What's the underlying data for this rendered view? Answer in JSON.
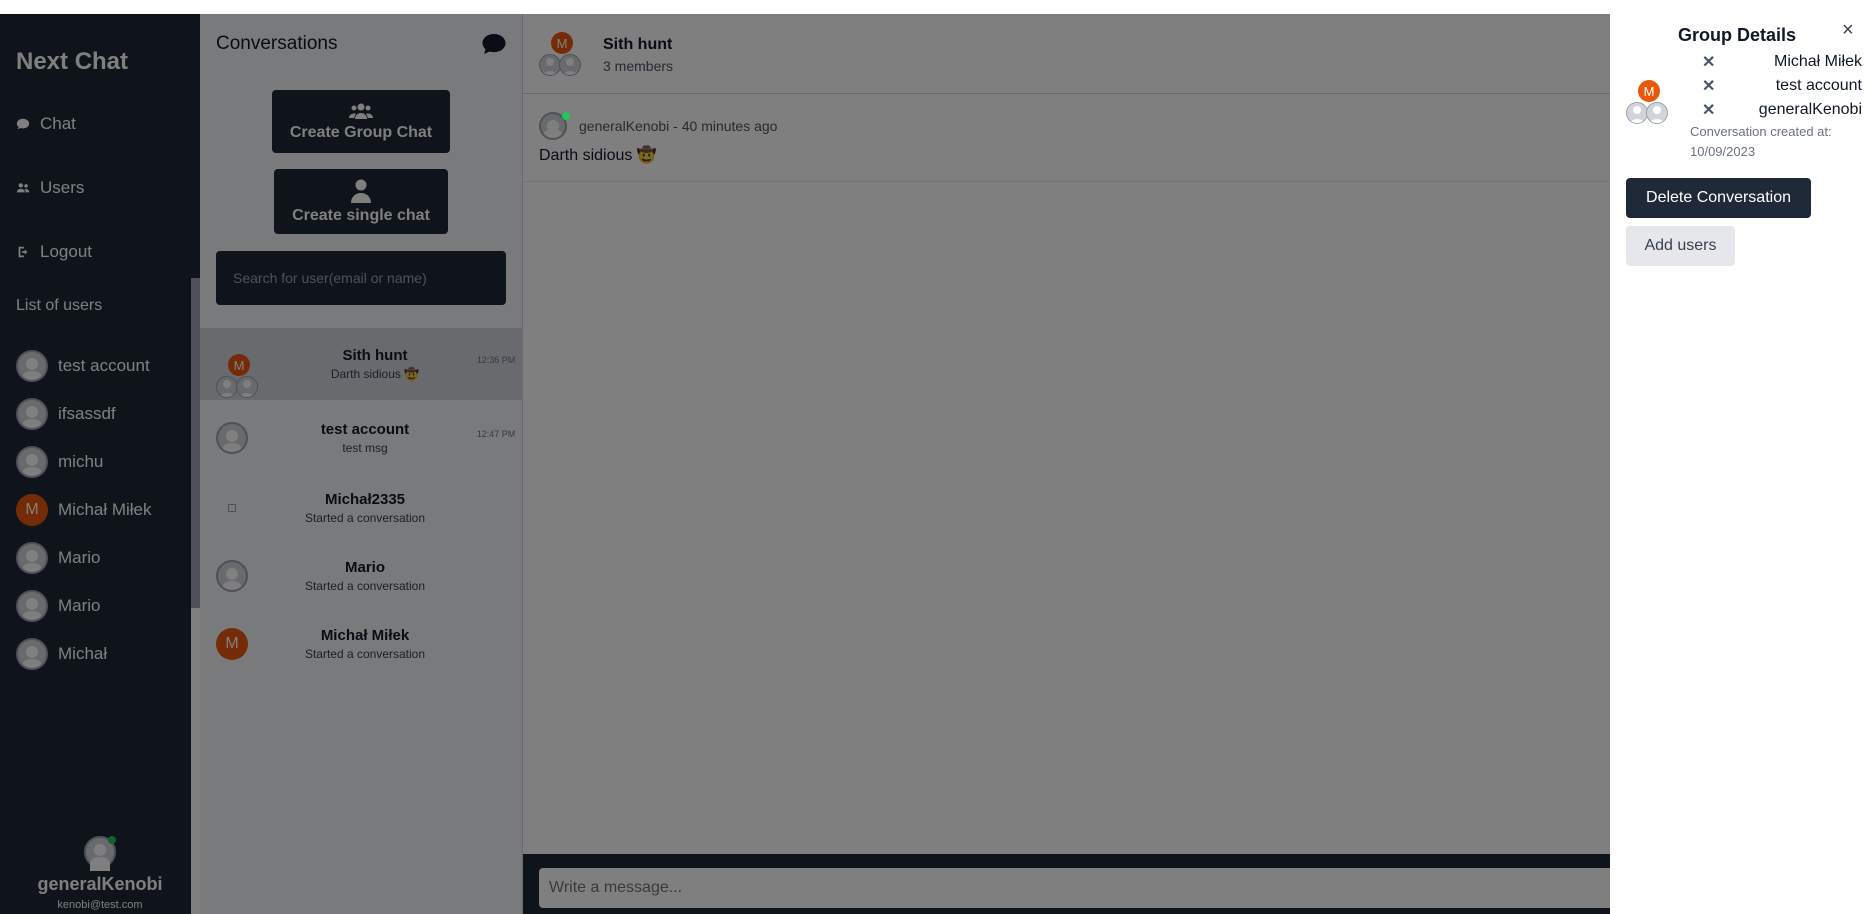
{
  "sidebar": {
    "brand": "Next Chat",
    "nav": [
      {
        "label": "Chat",
        "icon": "chat-icon"
      },
      {
        "label": "Users",
        "icon": "users-icon"
      },
      {
        "label": "Logout",
        "icon": "logout-icon"
      }
    ],
    "list_title": "List of users",
    "users": [
      {
        "name": "test account",
        "avatar": "default"
      },
      {
        "name": "ifsassdf",
        "avatar": "default"
      },
      {
        "name": "michu",
        "avatar": "default"
      },
      {
        "name": "Michał Miłek",
        "avatar": "M"
      },
      {
        "name": "Mario",
        "avatar": "default"
      },
      {
        "name": "Mario",
        "avatar": "default"
      },
      {
        "name": "Michał",
        "avatar": "default"
      }
    ],
    "me": {
      "name": "generalKenobi",
      "email": "kenobi@test.com"
    }
  },
  "conversations": {
    "title": "Conversations",
    "create_group_label": "Create Group Chat",
    "create_single_label": "Create single chat",
    "search_placeholder": "Search for user(email or name)",
    "items": [
      {
        "name": "Sith hunt",
        "last": "Darth sidious 🤠",
        "time": "12:36 PM",
        "avatar": "group"
      },
      {
        "name": "test account",
        "last": "test msg",
        "time": "12:47 PM",
        "avatar": "default"
      },
      {
        "name": "Michał2335",
        "last": "Started a conversation",
        "time": "",
        "avatar": "broken"
      },
      {
        "name": "Mario",
        "last": "Started a conversation",
        "time": "",
        "avatar": "default"
      },
      {
        "name": "Michał Miłek",
        "last": "Started a conversation",
        "time": "",
        "avatar": "M"
      }
    ]
  },
  "chat": {
    "title": "Sith hunt",
    "members": "3 members",
    "avatar_letter": "M",
    "message": {
      "author": "generalKenobi",
      "ago": "40 minutes ago",
      "meta": "generalKenobi - 40 minutes ago",
      "text": "Darth sidious 🤠"
    },
    "composer_placeholder": "Write a message..."
  },
  "details": {
    "title": "Group Details",
    "close": "×",
    "members": [
      "Michał Miłek",
      "test account",
      "generalKenobi"
    ],
    "remove_glyph": "✕",
    "created": "Conversation created at: 10/09/2023",
    "delete_label": "Delete Conversation",
    "add_label": "Add users"
  },
  "colors": {
    "dark": "#1f2937",
    "accent": "#ea580c",
    "online": "#22c55e"
  }
}
